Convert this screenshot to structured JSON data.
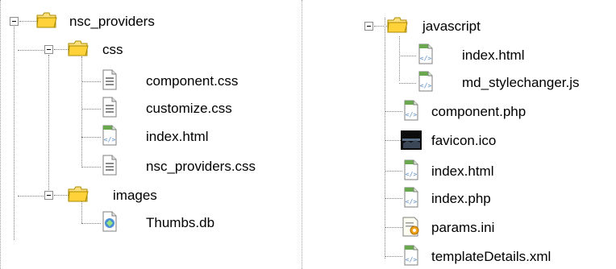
{
  "left_tree": {
    "root": {
      "label": "nsc_providers"
    },
    "css_folder": {
      "label": "css"
    },
    "css_files": [
      {
        "label": "component.css"
      },
      {
        "label": "customize.css"
      },
      {
        "label": "index.html"
      },
      {
        "label": "nsc_providers.css"
      }
    ],
    "images_folder": {
      "label": "images"
    },
    "images_files": [
      {
        "label": "Thumbs.db"
      }
    ]
  },
  "right_tree": {
    "js_folder": {
      "label": "javascript"
    },
    "js_files": [
      {
        "label": "index.html"
      },
      {
        "label": "md_stylechanger.js"
      }
    ],
    "files": [
      {
        "label": "component.php"
      },
      {
        "label": "favicon.ico"
      },
      {
        "label": "index.html"
      },
      {
        "label": "index.php"
      },
      {
        "label": "params.ini"
      },
      {
        "label": "templateDetails.xml"
      }
    ]
  },
  "colors": {
    "folder_fill": "#ffe07a",
    "folder_stroke": "#a88a00",
    "doc_green": "#6aa84f"
  }
}
